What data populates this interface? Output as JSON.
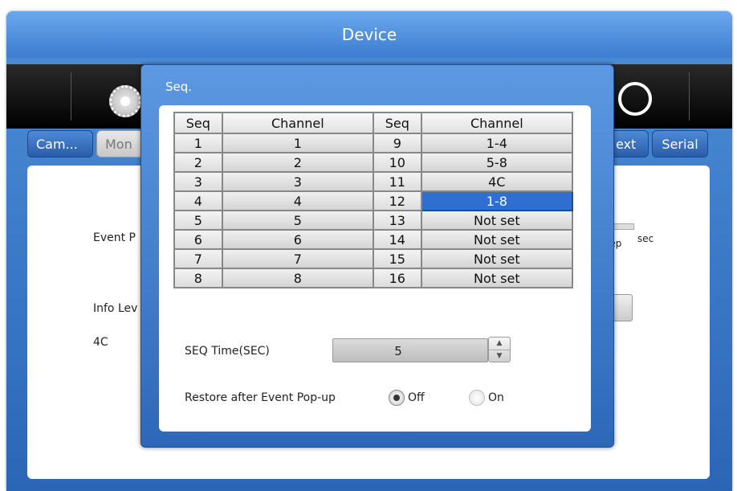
{
  "window": {
    "title": "Device",
    "tabs": [
      "Cam...",
      "Mon",
      "ext",
      "Serial"
    ],
    "background_labels": {
      "event": "Event P",
      "info": "Info Lev",
      "mode": "4C",
      "sec": "sec",
      "sleep": "eep"
    }
  },
  "dialog": {
    "title": "Seq.",
    "table": {
      "headers": [
        "Seq",
        "Channel",
        "Seq",
        "Channel"
      ],
      "rows": [
        {
          "seq_a": "1",
          "ch_a": "1",
          "seq_b": "9",
          "ch_b": "1-4"
        },
        {
          "seq_a": "2",
          "ch_a": "2",
          "seq_b": "10",
          "ch_b": "5-8"
        },
        {
          "seq_a": "3",
          "ch_a": "3",
          "seq_b": "11",
          "ch_b": "4C"
        },
        {
          "seq_a": "4",
          "ch_a": "4",
          "seq_b": "12",
          "ch_b": "1-8"
        },
        {
          "seq_a": "5",
          "ch_a": "5",
          "seq_b": "13",
          "ch_b": "Not set"
        },
        {
          "seq_a": "6",
          "ch_a": "6",
          "seq_b": "14",
          "ch_b": "Not set"
        },
        {
          "seq_a": "7",
          "ch_a": "7",
          "seq_b": "15",
          "ch_b": "Not set"
        },
        {
          "seq_a": "8",
          "ch_a": "8",
          "seq_b": "16",
          "ch_b": "Not set"
        }
      ],
      "selected_cell": "12"
    },
    "seq_time": {
      "label": "SEQ Time(SEC)",
      "value": "5"
    },
    "restore": {
      "label": "Restore after Event Pop-up",
      "options": [
        "Off",
        "On"
      ],
      "selected": "Off"
    }
  },
  "icons": [
    "gear-icon",
    "network-icon",
    "spin-up-icon",
    "spin-down-icon"
  ]
}
